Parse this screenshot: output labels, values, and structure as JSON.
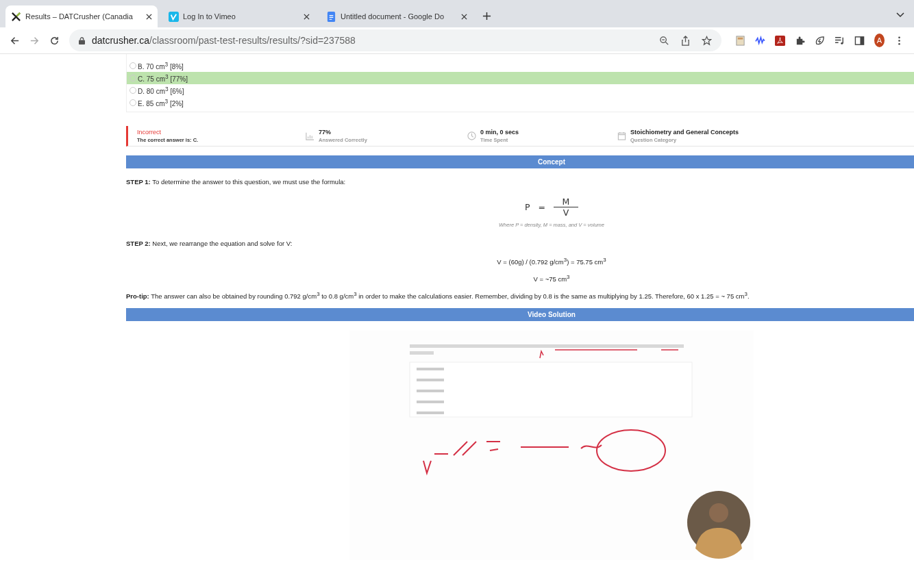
{
  "browser": {
    "tabs": [
      {
        "title": "Results – DATCrusher (Canadia",
        "selected": true
      },
      {
        "title": "Log In to Vimeo",
        "selected": false
      },
      {
        "title": "Untitled document - Google Do",
        "selected": false
      }
    ],
    "address": {
      "domain": "datcrusher.ca",
      "path": "/classroom/past-test-results/results/?sid=237588"
    },
    "avatar": "A"
  },
  "options": [
    {
      "label": "B. 70 cm$^{3}$ [8%]",
      "correct": false
    },
    {
      "label": "C. 75 cm$^{3}$ [77%]",
      "correct": true
    },
    {
      "label": "D. 80 cm$^{3}$ [6%]",
      "correct": false
    },
    {
      "label": "E. 85 cm$^{3}$ [2%]",
      "correct": false
    }
  ],
  "result": {
    "status": "Incorrect",
    "detail": "The correct answer is: C."
  },
  "stats": [
    {
      "kind": "chart",
      "value": "77%",
      "label": "Answered Correctly"
    },
    {
      "kind": "clock",
      "value": "0 min, 0 secs",
      "label": "Time Spent"
    },
    {
      "kind": "calendar",
      "value": "Stoichiometry and General Concepts",
      "label": "Question Category"
    }
  ],
  "concept": {
    "title": "Concept",
    "step1": "**STEP 1:** To determine the answer to this question, we must use the formula:",
    "formula": {
      "left": "P",
      "equals": "=",
      "numerator": "M",
      "denominator": "V"
    },
    "caption": "Where P = density, M = mass, and V = volume",
    "step2": "**STEP 2:** Next, we rearrange the equation and solve for V:",
    "equations": [
      "V = (60g) / (0.792 g/cm$^{3}$) = 75.75 cm$^{3}$",
      "V = ~75 cm$^{3}$"
    ],
    "protip": "**Pro-tip:** The answer can also be obtained by rounding 0.792 g/cm$^{3}$ to 0.8 g/cm$^{3}$ in order to make the calculations easier. Remember, dividing by 0.8 is the same as multiplying by 1.25. Therefore, 60 x 1.25 = ~ 75 cm$^{3}$."
  },
  "video": {
    "title": "Video Solution"
  }
}
